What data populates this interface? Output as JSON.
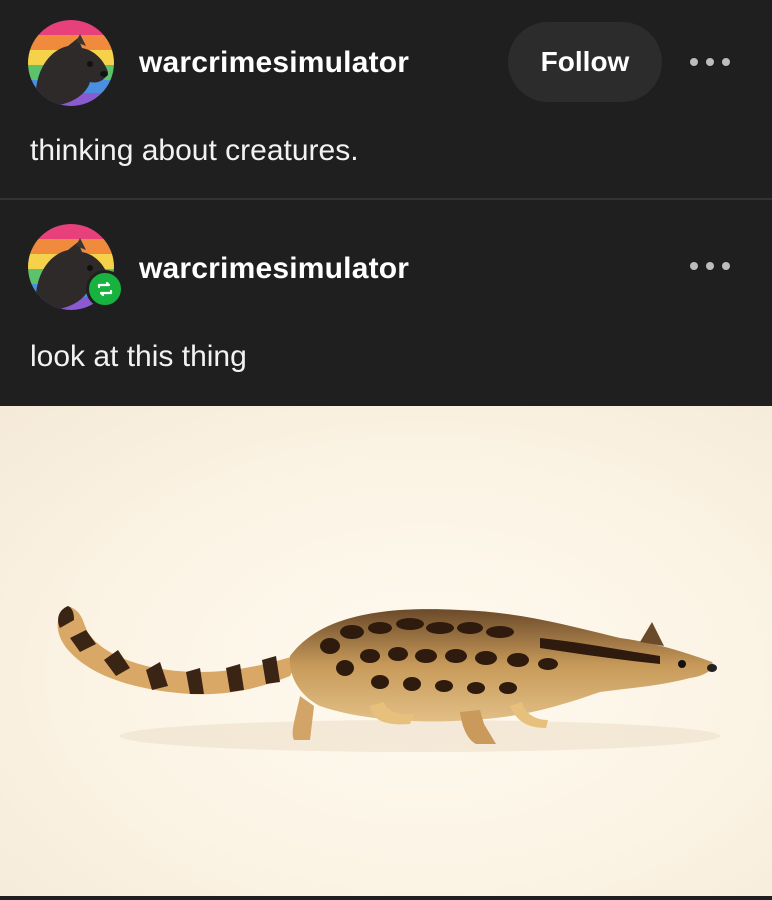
{
  "posts": [
    {
      "username": "warcrimesimulator",
      "follow_label": "Follow",
      "text": "thinking about creatures."
    },
    {
      "username": "warcrimesimulator",
      "text": "look at this thing"
    }
  ],
  "icons": {
    "more": "more-options-icon",
    "reblog": "reblog-icon"
  },
  "colors": {
    "background": "#1f1f1f",
    "follow_button": "#2c2c2c",
    "reblog_badge": "#18b33f"
  }
}
